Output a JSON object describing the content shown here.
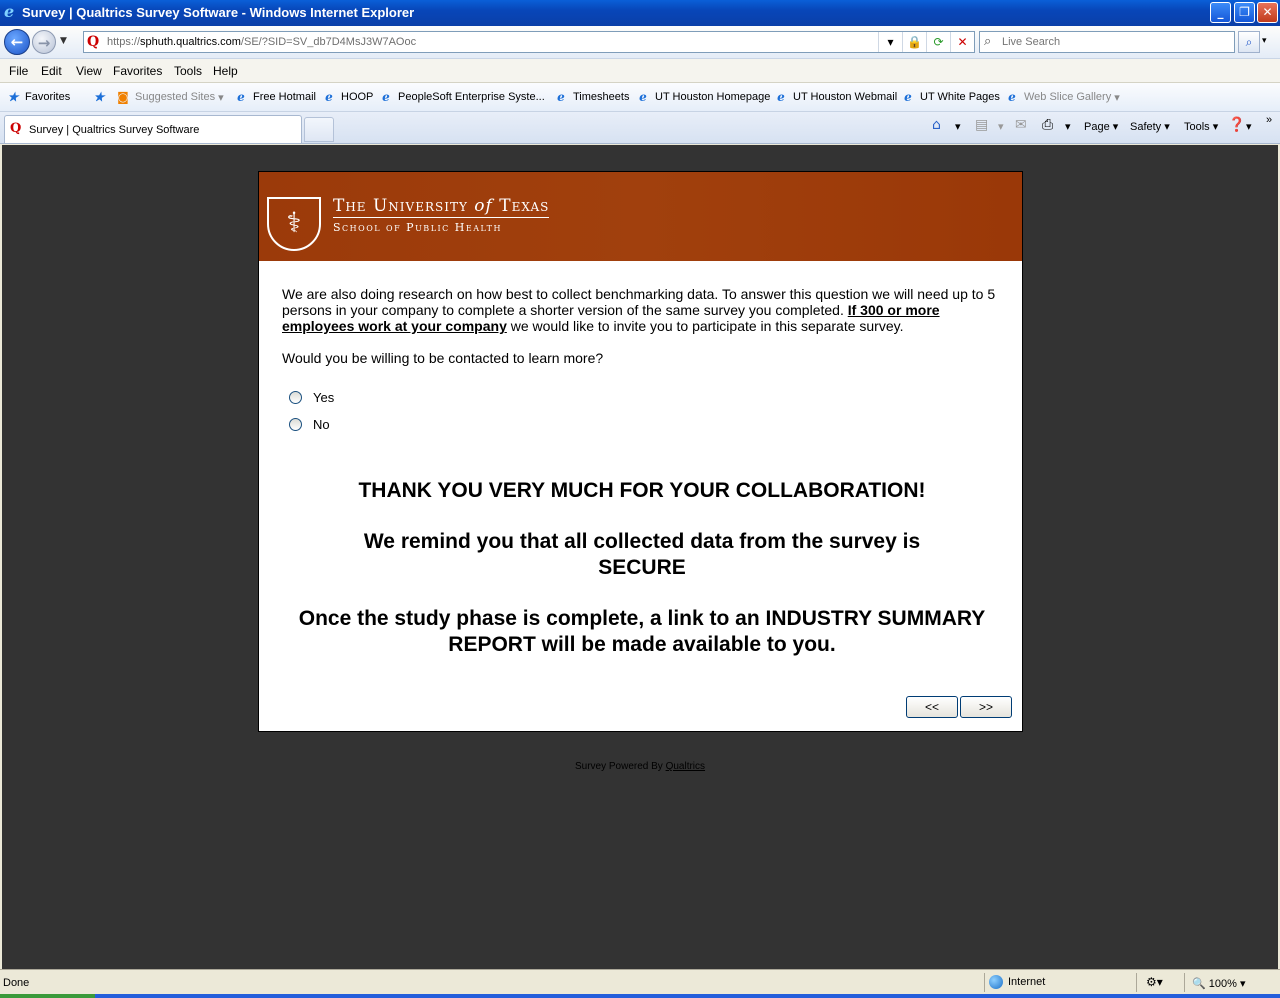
{
  "window": {
    "title": "Survey | Qualtrics Survey Software - Windows Internet Explorer"
  },
  "address": {
    "url_prefix": "https://",
    "url_host": "sphuth.qualtrics.com",
    "url_path": "/SE/?SID=SV_db7D4MsJ3W7AOoc"
  },
  "search": {
    "placeholder": "Live Search"
  },
  "menu": {
    "file": "File",
    "edit": "Edit",
    "view": "View",
    "favorites": "Favorites",
    "tools": "Tools",
    "help": "Help"
  },
  "favbar": {
    "favorites": "Favorites",
    "items": [
      "Suggested Sites",
      "Free Hotmail",
      "HOOP",
      "PeopleSoft Enterprise Syste...",
      "Timesheets",
      "UT Houston Homepage",
      "UT Houston Webmail",
      "UT White Pages",
      "Web Slice Gallery"
    ]
  },
  "tabs": {
    "active": "Survey | Qualtrics Survey Software"
  },
  "commandbar": {
    "page": "Page",
    "safety": "Safety",
    "tools": "Tools"
  },
  "banner": {
    "line1_a": "The University",
    "line1_of": "of",
    "line1_b": "Texas",
    "line2": "School of Public Health"
  },
  "survey": {
    "para_part1": "We are also doing research on how best to collect benchmarking data. To answer this question we will need up to 5 persons in your company to complete a shorter version of the same survey you completed. ",
    "para_bold": "If 300 or more employees work at your company",
    "para_part2": " we would like to invite you to participate in this separate survey.",
    "question": "Would you be willing to be contacted to learn more?",
    "choices": [
      "Yes",
      "No"
    ],
    "thanks": "THANK YOU VERY MUCH FOR YOUR COLLABORATION!",
    "remind_line1": "We remind you that all collected data from the survey is",
    "remind_line2": "SECURE",
    "report_line1": "Once the study phase is complete, a link to an INDUSTRY SUMMARY",
    "report_line2": "REPORT will be made available to you.",
    "prev_button": "<<",
    "next_button": ">>"
  },
  "footer": {
    "powered_by": "Survey Powered By ",
    "qualtrics_link": "Qualtrics"
  },
  "status": {
    "done": "Done",
    "zone": "Internet",
    "zoom": "100%"
  }
}
